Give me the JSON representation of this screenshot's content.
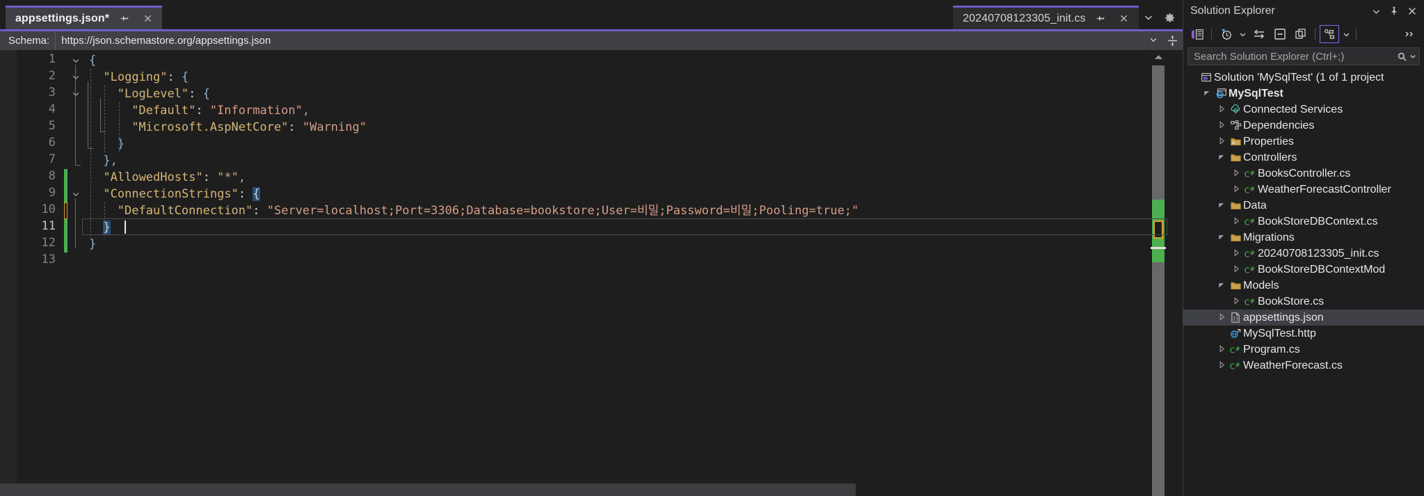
{
  "editor": {
    "tabs": [
      {
        "title": "appsettings.json*",
        "active": true,
        "pin_icon": "pin-icon",
        "close_icon": "close-icon"
      },
      {
        "title": "20240708123305_init.cs",
        "active": false,
        "pin_icon": "pin-icon",
        "close_icon": "close-icon"
      }
    ],
    "tabstrip_buttons": [
      {
        "name": "tab-list-dropdown",
        "icon": "chevron-down-icon"
      },
      {
        "name": "editor-settings",
        "icon": "gear-icon"
      }
    ],
    "schema": {
      "label": "Schema:",
      "value": "https://json.schemastore.org/appsettings.json",
      "dropdown_icon": "chevron-down-icon",
      "split_icon": "split-view-icon"
    },
    "code": {
      "language": "json",
      "current_line": 11,
      "lines": [
        {
          "n": 1,
          "indent": 0,
          "fold": "expanded",
          "tokens": [
            {
              "t": "brace",
              "v": "{"
            }
          ]
        },
        {
          "n": 2,
          "indent": 1,
          "fold": "expanded",
          "tokens": [
            {
              "t": "key",
              "v": "\"Logging\""
            },
            {
              "t": "punct",
              "v": ": "
            },
            {
              "t": "brace",
              "v": "{"
            }
          ]
        },
        {
          "n": 3,
          "indent": 2,
          "fold": "expanded",
          "tokens": [
            {
              "t": "key",
              "v": "\"LogLevel\""
            },
            {
              "t": "punct",
              "v": ": "
            },
            {
              "t": "brace",
              "v": "{"
            }
          ]
        },
        {
          "n": 4,
          "indent": 3,
          "fold": "none",
          "tokens": [
            {
              "t": "key",
              "v": "\"Default\""
            },
            {
              "t": "punct",
              "v": ": "
            },
            {
              "t": "str",
              "v": "\"Information\""
            },
            {
              "t": "comma",
              "v": ","
            }
          ]
        },
        {
          "n": 5,
          "indent": 3,
          "fold": "none",
          "tokens": [
            {
              "t": "key",
              "v": "\"Microsoft.AspNetCore\""
            },
            {
              "t": "punct",
              "v": ": "
            },
            {
              "t": "str",
              "v": "\"Warning\""
            }
          ]
        },
        {
          "n": 6,
          "indent": 2,
          "fold": "none",
          "tokens": [
            {
              "t": "brace",
              "v": "}"
            }
          ]
        },
        {
          "n": 7,
          "indent": 1,
          "fold": "none",
          "tokens": [
            {
              "t": "brace",
              "v": "}"
            },
            {
              "t": "comma",
              "v": ","
            }
          ]
        },
        {
          "n": 8,
          "indent": 1,
          "fold": "none",
          "tokens": [
            {
              "t": "key",
              "v": "\"AllowedHosts\""
            },
            {
              "t": "punct",
              "v": ": "
            },
            {
              "t": "str",
              "v": "\"*\""
            },
            {
              "t": "comma",
              "v": ","
            }
          ]
        },
        {
          "n": 9,
          "indent": 1,
          "fold": "expanded",
          "tokens": [
            {
              "t": "key",
              "v": "\"ConnectionStrings\""
            },
            {
              "t": "punct",
              "v": ": "
            },
            {
              "t": "brace-sel",
              "v": "{"
            }
          ]
        },
        {
          "n": 10,
          "indent": 2,
          "fold": "none",
          "tokens": [
            {
              "t": "key",
              "v": "\"DefaultConnection\""
            },
            {
              "t": "punct",
              "v": ": "
            },
            {
              "t": "str",
              "v": "\"Server=localhost;Port=3306;Database=bookstore;User=비밀;Password=비밀;Pooling=true;\""
            }
          ]
        },
        {
          "n": 11,
          "indent": 1,
          "fold": "none",
          "tokens": [
            {
              "t": "brace-sel",
              "v": "}"
            }
          ]
        },
        {
          "n": 12,
          "indent": 0,
          "fold": "none",
          "tokens": [
            {
              "t": "brace",
              "v": "}"
            }
          ]
        },
        {
          "n": 13,
          "indent": 0,
          "fold": "none",
          "tokens": []
        }
      ],
      "change_markers": [
        {
          "from_line": 8,
          "to_line": 9,
          "color": "#4caf50"
        },
        {
          "from_line": 10,
          "to_line": 10,
          "color": "#e0a030"
        },
        {
          "from_line": 11,
          "to_line": 12,
          "color": "#4caf50"
        }
      ]
    },
    "scrollbar": {
      "up_arrow_icon": "chevron-up-icon",
      "marks": [
        "changes-green",
        "cursor-white",
        "bookmark-orange"
      ]
    }
  },
  "solution_explorer": {
    "title": "Solution Explorer",
    "header_buttons": [
      {
        "name": "solution-explorer-dropdown",
        "icon": "chevron-down-icon"
      },
      {
        "name": "pin-window-button",
        "icon": "pin-icon"
      },
      {
        "name": "close-window-button",
        "icon": "close-icon"
      }
    ],
    "toolbar_buttons": [
      {
        "name": "switch-views-button",
        "icon": "vs-views-icon"
      },
      {
        "name": "pending-changes-filter-button",
        "icon": "clock-filter-icon"
      },
      {
        "name": "pending-changes-filter-dropdown",
        "icon": "chevron-down-icon"
      },
      {
        "name": "sync-with-active-document-button",
        "icon": "sync-arrows-icon"
      },
      {
        "name": "collapse-all-button",
        "icon": "collapse-all-icon"
      },
      {
        "name": "show-all-files-button",
        "icon": "show-all-files-icon"
      },
      {
        "name": "properties-button",
        "icon": "properties-graph-icon"
      },
      {
        "name": "properties-dropdown",
        "icon": "chevron-down-icon"
      },
      {
        "name": "overflow-button",
        "icon": "overflow-chevrons-icon"
      }
    ],
    "search": {
      "placeholder": "Search Solution Explorer (Ctrl+;)",
      "search_icon": "magnifier-icon",
      "dropdown_icon": "chevron-down-icon"
    },
    "tree": [
      {
        "depth": 0,
        "arrow": "none",
        "icon": "solution-icon",
        "label": "Solution 'MySqlTest'  (1 of 1 project",
        "bold": false,
        "selected": false
      },
      {
        "depth": 1,
        "arrow": "expanded",
        "icon": "web-project-icon",
        "label": "MySqlTest",
        "bold": true,
        "selected": false
      },
      {
        "depth": 2,
        "arrow": "collapsed",
        "icon": "connected-services-icon",
        "label": "Connected Services",
        "bold": false,
        "selected": false
      },
      {
        "depth": 2,
        "arrow": "collapsed",
        "icon": "dependencies-icon",
        "label": "Dependencies",
        "bold": false,
        "selected": false
      },
      {
        "depth": 2,
        "arrow": "collapsed",
        "icon": "properties-folder-icon",
        "label": "Properties",
        "bold": false,
        "selected": false
      },
      {
        "depth": 2,
        "arrow": "expanded",
        "icon": "folder-icon",
        "label": "Controllers",
        "bold": false,
        "selected": false
      },
      {
        "depth": 3,
        "arrow": "collapsed",
        "icon": "csharp-file-icon",
        "label": "BooksController.cs",
        "bold": false,
        "selected": false
      },
      {
        "depth": 3,
        "arrow": "collapsed",
        "icon": "csharp-file-icon",
        "label": "WeatherForecastController",
        "bold": false,
        "selected": false
      },
      {
        "depth": 2,
        "arrow": "expanded",
        "icon": "folder-icon",
        "label": "Data",
        "bold": false,
        "selected": false
      },
      {
        "depth": 3,
        "arrow": "collapsed",
        "icon": "csharp-file-icon",
        "label": "BookStoreDBContext.cs",
        "bold": false,
        "selected": false
      },
      {
        "depth": 2,
        "arrow": "expanded",
        "icon": "folder-icon",
        "label": "Migrations",
        "bold": false,
        "selected": false
      },
      {
        "depth": 3,
        "arrow": "collapsed",
        "icon": "csharp-file-icon",
        "label": "20240708123305_init.cs",
        "bold": false,
        "selected": false
      },
      {
        "depth": 3,
        "arrow": "collapsed",
        "icon": "csharp-file-icon",
        "label": "BookStoreDBContextMod",
        "bold": false,
        "selected": false
      },
      {
        "depth": 2,
        "arrow": "expanded",
        "icon": "folder-icon",
        "label": "Models",
        "bold": false,
        "selected": false
      },
      {
        "depth": 3,
        "arrow": "collapsed",
        "icon": "csharp-file-icon",
        "label": "BookStore.cs",
        "bold": false,
        "selected": false
      },
      {
        "depth": 2,
        "arrow": "collapsed",
        "icon": "json-file-icon",
        "label": "appsettings.json",
        "bold": false,
        "selected": true
      },
      {
        "depth": 2,
        "arrow": "none",
        "icon": "http-file-icon",
        "label": "MySqlTest.http",
        "bold": false,
        "selected": false
      },
      {
        "depth": 2,
        "arrow": "collapsed",
        "icon": "csharp-file-icon",
        "label": "Program.cs",
        "bold": false,
        "selected": false
      },
      {
        "depth": 2,
        "arrow": "collapsed",
        "icon": "csharp-file-icon",
        "label": "WeatherForecast.cs",
        "bold": false,
        "selected": false
      }
    ]
  },
  "colors": {
    "accent_purple": "#6b5fc7",
    "background": "#1e1e1e",
    "panel": "#2d2d30",
    "tab_active": "#3f3f46",
    "json_key": "#d6b677",
    "json_string": "#d69d85",
    "change_green": "#4caf50",
    "change_orange": "#e0a030"
  }
}
